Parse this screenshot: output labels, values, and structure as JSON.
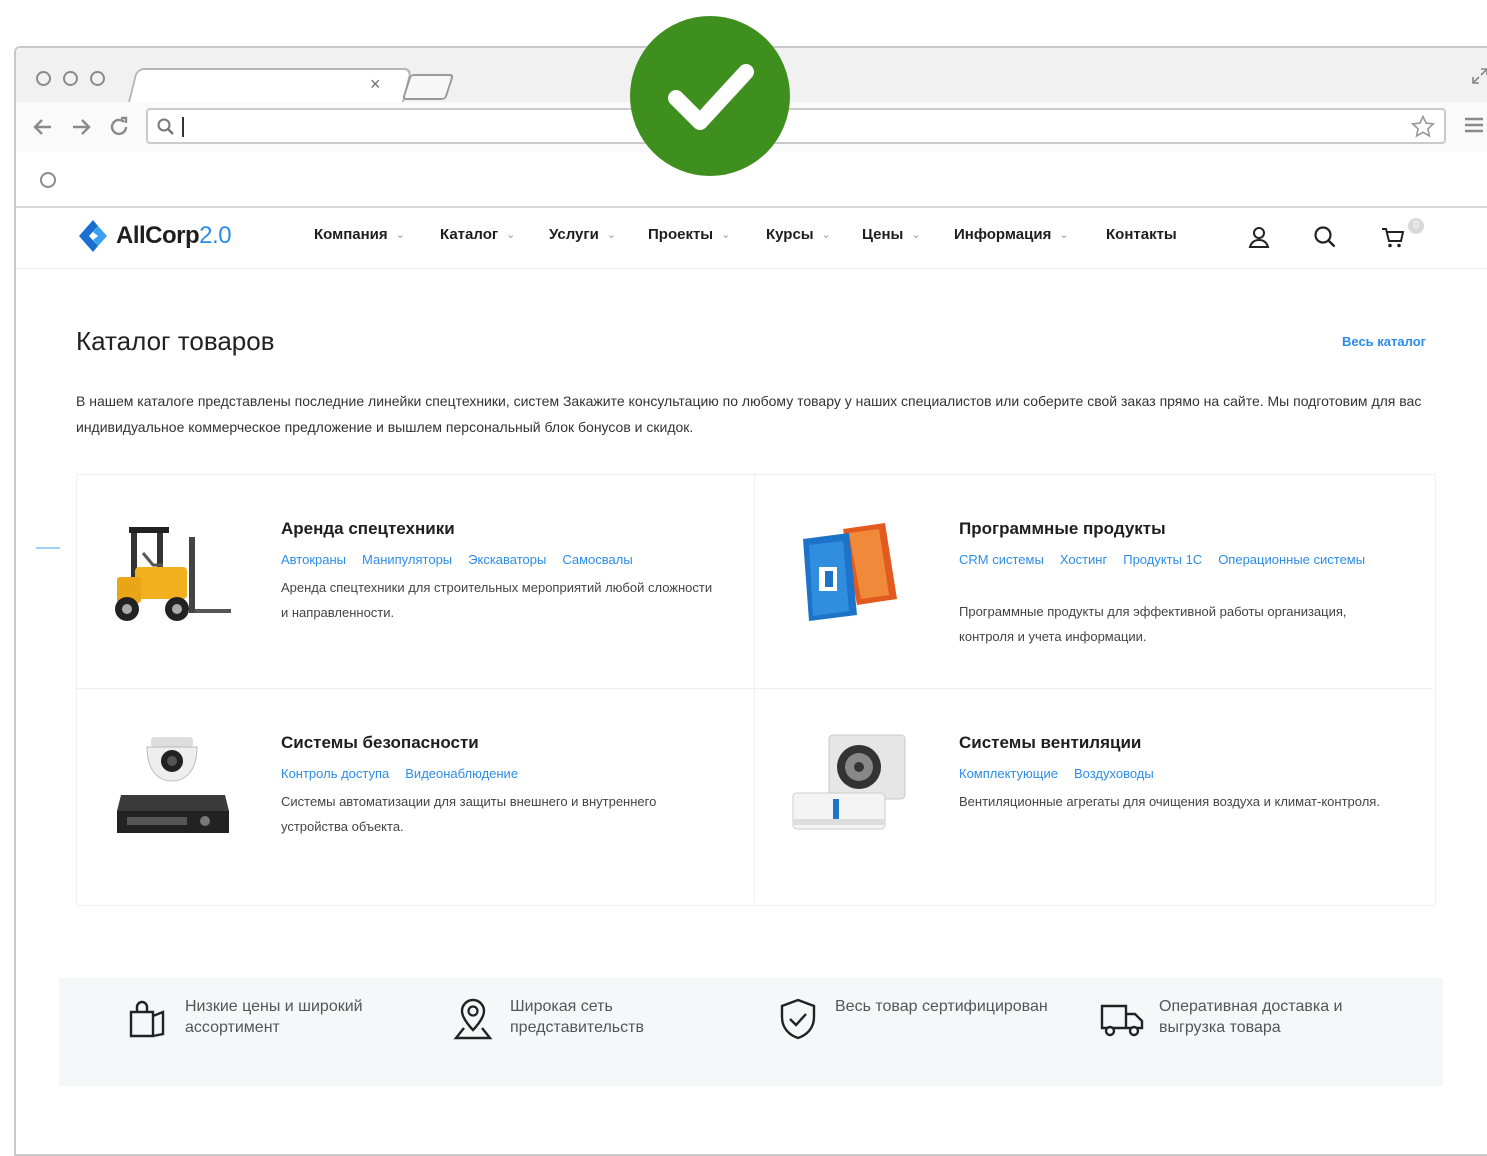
{
  "browser": {
    "tab_close": "×",
    "address_value": ""
  },
  "site": {
    "logo": {
      "name": "AllCorp",
      "version": "2.0"
    },
    "nav": [
      {
        "label": "Компания",
        "has_dropdown": true
      },
      {
        "label": "Каталог",
        "has_dropdown": true
      },
      {
        "label": "Услуги",
        "has_dropdown": true
      },
      {
        "label": "Проекты",
        "has_dropdown": true
      },
      {
        "label": "Курсы",
        "has_dropdown": true
      },
      {
        "label": "Цены",
        "has_dropdown": true
      },
      {
        "label": "Информация",
        "has_dropdown": true
      },
      {
        "label": "Контакты",
        "has_dropdown": false
      }
    ],
    "nav_chevron": "⌄",
    "cart_count": "0",
    "icons": [
      "user-icon",
      "search-icon",
      "cart-icon"
    ]
  },
  "catalog": {
    "title": "Каталог товаров",
    "all_link": "Весь каталог",
    "intro": "В нашем каталоге представлены последние линейки спецтехники, систем Закажите консультацию по любому товару у наших специалистов или соберите свой заказ прямо на сайте. Мы подготовим для вас индивидуальное коммерческое предложение и вышлем персональный блок бонусов и скидок.",
    "categories": [
      {
        "title": "Аренда спецтехники",
        "links": [
          "Автокраны",
          "Манипуляторы",
          "Экскаваторы",
          "Самосвалы"
        ],
        "desc": "Аренда спецтехники для строительных мероприятий любой сложности и направленности.",
        "image": "forklift"
      },
      {
        "title": "Программные продукты",
        "links": [
          "CRM системы",
          "Хостинг",
          "Продукты 1С",
          "Операционные системы"
        ],
        "desc": "Программные продукты для эффективной работы организация, контроля и учета информации.",
        "image": "office-box"
      },
      {
        "title": "Системы безопасности",
        "links": [
          "Контроль доступа",
          "Видеонаблюдение"
        ],
        "desc": "Системы автоматизации для защиты внешнего и внутреннего устройства объекта.",
        "image": "camera-dvr"
      },
      {
        "title": "Системы вентиляции",
        "links": [
          "Комплектующие",
          "Воздуховоды"
        ],
        "desc": "Вентиляционные агрегаты для очищения воздуха и климат-контроля.",
        "image": "air-conditioner"
      }
    ]
  },
  "benefits": [
    {
      "text": "Низкие цены и широкий ассортимент",
      "icon": "shopping-bag-icon"
    },
    {
      "text": "Широкая сеть представительств",
      "icon": "location-pin-icon"
    },
    {
      "text": "Весь товар сертифицирован",
      "icon": "shield-check-icon"
    },
    {
      "text": "Оперативная доставка и выгрузка товара",
      "icon": "truck-icon"
    }
  ],
  "colors": {
    "accent": "#2c8de8",
    "check_green": "#3f8f1f",
    "text": "#1e1e1e"
  }
}
